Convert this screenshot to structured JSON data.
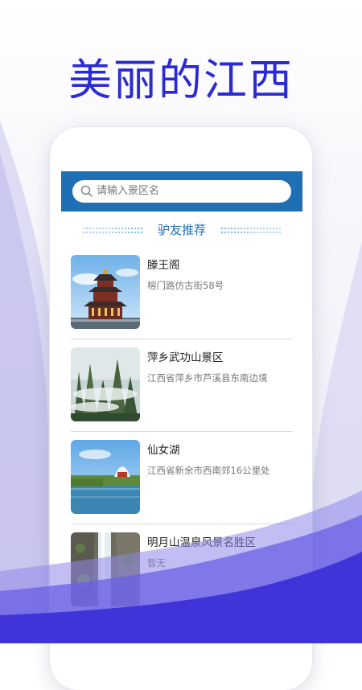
{
  "headline": "美丽的江西",
  "search": {
    "placeholder": "请输入景区名"
  },
  "section": {
    "title": "驴友推荐"
  },
  "items": [
    {
      "name": "滕王阁",
      "address": "榕门路仿古街58号",
      "image": "pavilion-photo"
    },
    {
      "name": "萍乡武功山景区",
      "address": "江西省萍乡市芦溪县东南边境",
      "image": "mountain-peaks-photo"
    },
    {
      "name": "仙女湖",
      "address": "江西省新余市西南郊16公里处",
      "image": "lake-photo"
    },
    {
      "name": "明月山温泉风景名胜区",
      "address": "暂无",
      "image": "waterfall-photo"
    }
  ],
  "colors": {
    "accent": "#2a2ad6",
    "header_bar": "#1f6fb5",
    "wave": "#4b3fe0"
  }
}
